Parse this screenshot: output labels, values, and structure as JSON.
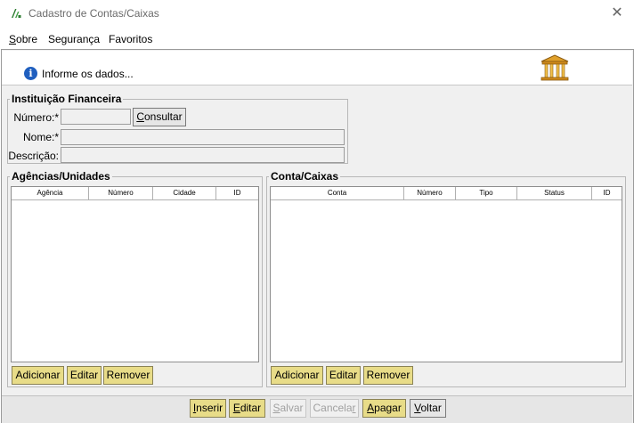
{
  "window": {
    "title": "Cadastro de Contas/Caixas",
    "close_glyph": "✕"
  },
  "menu": {
    "items": [
      {
        "label_u": "S",
        "label_rest": "obre"
      },
      {
        "label_u": "",
        "label_rest": "Segurança"
      },
      {
        "label_u": "",
        "label_rest": "Favoritos"
      }
    ]
  },
  "header": {
    "info_text": "Informe os dados..."
  },
  "instituicao": {
    "legend": "Instituição Financeira",
    "numero_label": "Número:*",
    "numero_value": "",
    "consultar_u": "C",
    "consultar_rest": "onsultar",
    "nome_label": "Nome:*",
    "nome_value": "",
    "descricao_label": "Descrição:",
    "descricao_value": ""
  },
  "agencias": {
    "legend": "Agências/Unidades",
    "columns": [
      "Agência",
      "Número",
      "Cidade",
      "ID"
    ],
    "rows": [],
    "buttons": {
      "add": "Adicionar",
      "edit": "Editar",
      "remove": "Remover"
    }
  },
  "contas": {
    "legend": "Conta/Caixas",
    "columns": [
      "Conta",
      "Número",
      "Tipo",
      "Status",
      "ID"
    ],
    "rows": [],
    "buttons": {
      "add": "Adicionar",
      "edit": "Editar",
      "remove": "Remover"
    }
  },
  "actions": {
    "inserir_u": "I",
    "inserir_rest": "nserir",
    "editar_u": "E",
    "editar_rest": "ditar",
    "salvar_u": "S",
    "salvar_rest": "alvar",
    "cancelar_pre": "Cancela",
    "cancelar_u": "r",
    "apagar_u": "A",
    "apagar_rest": "pagar",
    "voltar_u": "V",
    "voltar_rest": "oltar"
  },
  "colors": {
    "action_button": "#e8dc88",
    "info_blue": "#1f5fbf",
    "bank_gold": "#e0a02a"
  },
  "icons": {
    "app": "app-logo-icon",
    "info": "info-icon",
    "bank": "bank-building-icon",
    "close": "close-icon"
  }
}
